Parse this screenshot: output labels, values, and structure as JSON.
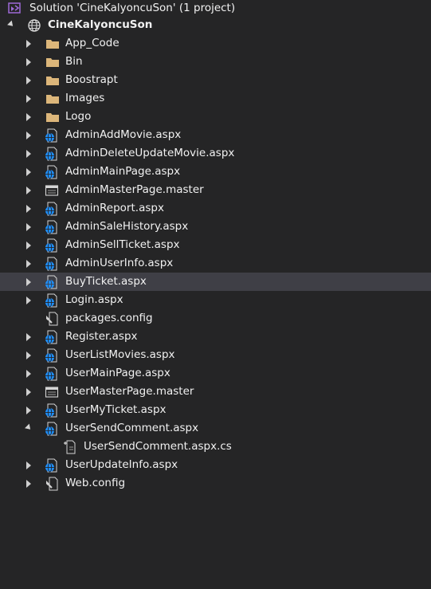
{
  "solution": {
    "label": "Solution 'CineKalyoncuSon' (1 project)"
  },
  "project": {
    "label": "CineKalyoncuSon"
  },
  "items": [
    {
      "label": "App_Code"
    },
    {
      "label": "Bin"
    },
    {
      "label": "Boostrapt"
    },
    {
      "label": "Images"
    },
    {
      "label": "Logo"
    },
    {
      "label": "AdminAddMovie.aspx"
    },
    {
      "label": "AdminDeleteUpdateMovie.aspx"
    },
    {
      "label": "AdminMainPage.aspx"
    },
    {
      "label": "AdminMasterPage.master"
    },
    {
      "label": "AdminReport.aspx"
    },
    {
      "label": "AdminSaleHistory.aspx"
    },
    {
      "label": "AdminSellTicket.aspx"
    },
    {
      "label": "AdminUserInfo.aspx"
    },
    {
      "label": "BuyTicket.aspx"
    },
    {
      "label": "Login.aspx"
    },
    {
      "label": "packages.config"
    },
    {
      "label": "Register.aspx"
    },
    {
      "label": "UserListMovies.aspx"
    },
    {
      "label": "UserMainPage.aspx"
    },
    {
      "label": "UserMasterPage.master"
    },
    {
      "label": "UserMyTicket.aspx"
    },
    {
      "label": "UserSendComment.aspx"
    },
    {
      "label": "UserSendComment.aspx.cs"
    },
    {
      "label": "UserUpdateInfo.aspx"
    },
    {
      "label": "Web.config"
    }
  ],
  "colors": {
    "background": "#252526",
    "selected_row": "#3f3f46",
    "text": "#f1f1f1",
    "folder": "#dcb67a",
    "globe": "#1e90ff",
    "vs_purple": "#9e6ad7"
  }
}
